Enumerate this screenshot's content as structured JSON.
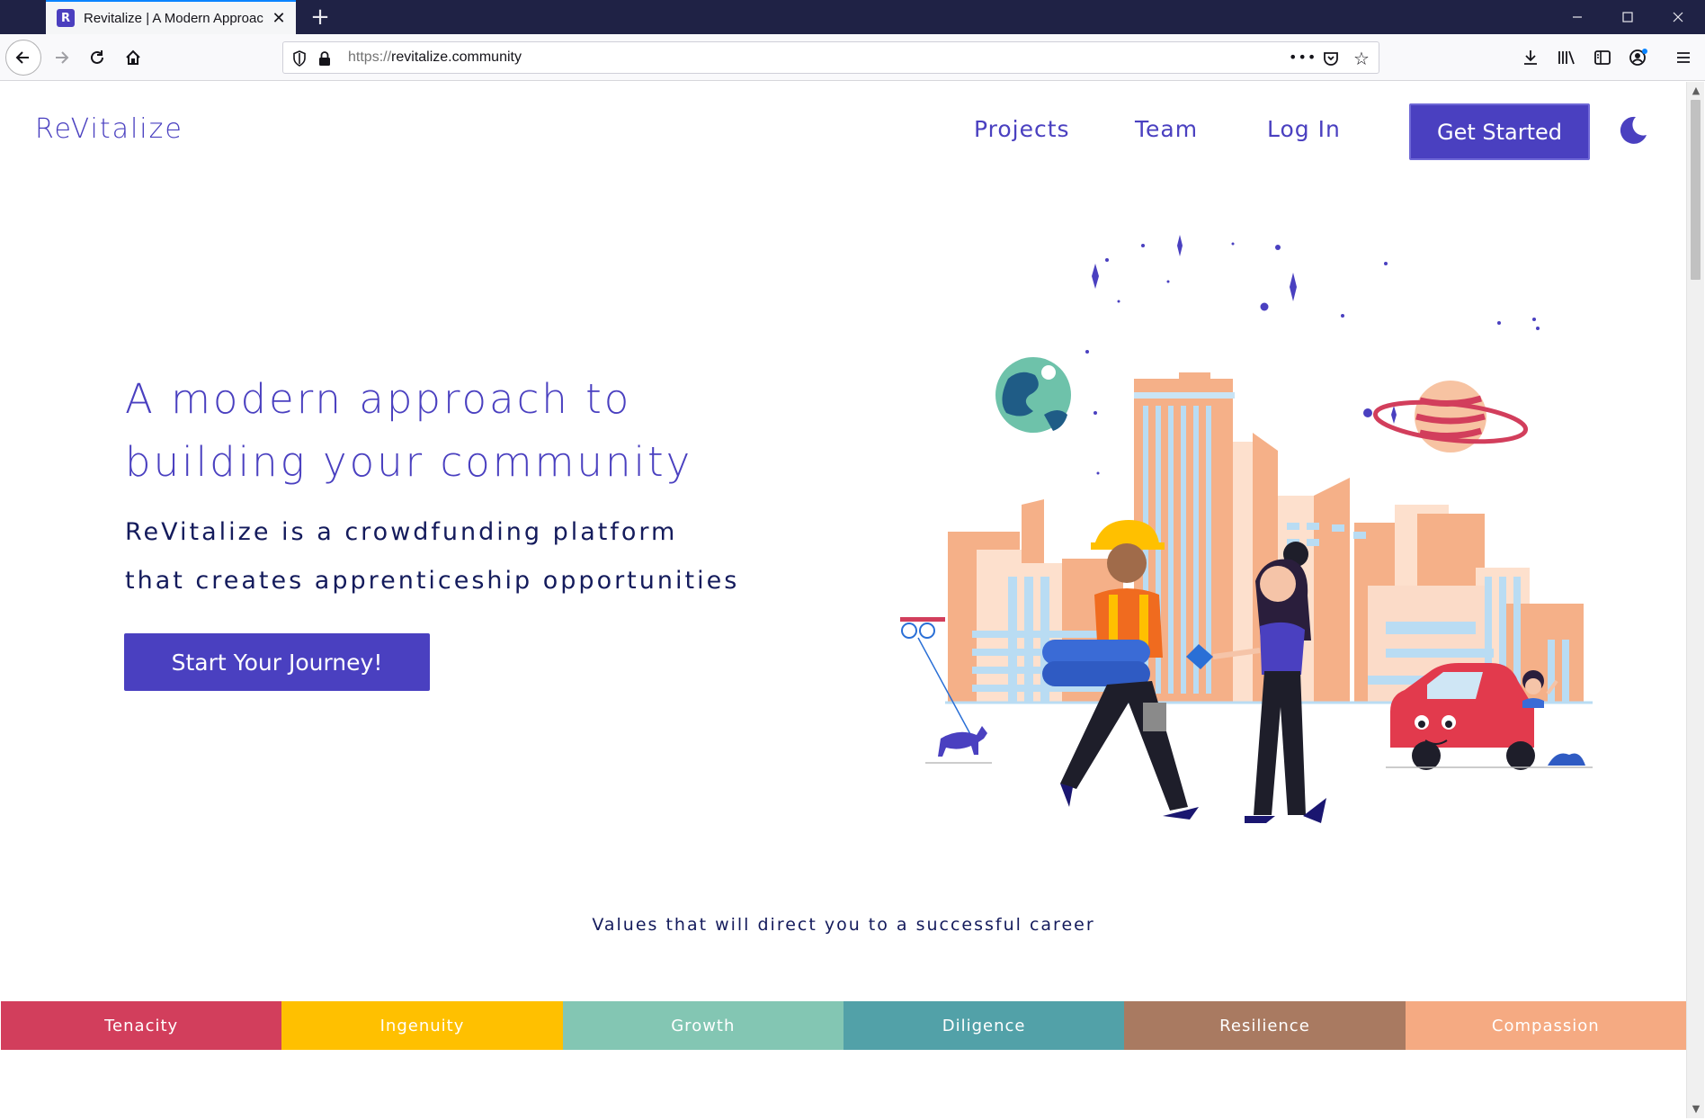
{
  "browser": {
    "tab_title": "Revitalize | A Modern Approach",
    "tab_favicon": "R",
    "new_tab": "+",
    "url_protocol": "https://",
    "url_host": "revitalize.community",
    "url_more": "•••"
  },
  "site": {
    "logo": "ReVitalize",
    "nav": {
      "projects": "Projects",
      "team": "Team",
      "login": "Log In",
      "get_started": "Get Started"
    },
    "hero": {
      "title_line1": "A modern approach to",
      "title_line2": "building your community",
      "sub_line1": "ReVitalize is a crowdfunding platform",
      "sub_line2": "that creates apprenticeship opportunities",
      "cta": "Start Your Journey!"
    },
    "values_heading": "Values that will direct you to a successful career",
    "values": [
      {
        "label": "Tenacity",
        "color": "#d23e5c"
      },
      {
        "label": "Ingenuity",
        "color": "#ffc000"
      },
      {
        "label": "Growth",
        "color": "#83c6b3"
      },
      {
        "label": "Diligence",
        "color": "#52a1a8"
      },
      {
        "label": "Resilience",
        "color": "#a97a61"
      },
      {
        "label": "Compassion",
        "color": "#f5aa82"
      }
    ]
  },
  "colors": {
    "brand": "#4a40c0",
    "dark_text": "#141b5c",
    "title_bar": "#1f2245"
  }
}
